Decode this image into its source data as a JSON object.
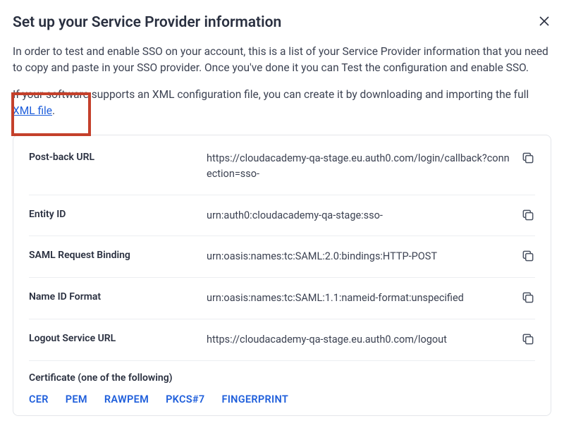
{
  "title": "Set up your Service Provider information",
  "desc1": "In order to test and enable SSO on your account, this is a list of your Service Provider information that you need to copy and paste in your SSO provider. Once you've done it you can Test the configuration and enable SSO.",
  "desc2_prefix": "If your software supports an XML configuration file, you can create it by downloading and importing the full ",
  "desc2_link": "XML file",
  "desc2_suffix": ".",
  "rows": {
    "postback": {
      "label": "Post-back URL",
      "value": "https://cloudacademy-qa-stage.eu.auth0.com/login/callback?connection=sso-"
    },
    "entity": {
      "label": "Entity ID",
      "value": "urn:auth0:cloudacademy-qa-stage:sso-"
    },
    "saml": {
      "label": "SAML Request Binding",
      "value": "urn:oasis:names:tc:SAML:2.0:bindings:HTTP-POST"
    },
    "nameid": {
      "label": "Name ID Format",
      "value": "urn:oasis:names:tc:SAML:1.1:nameid-format:unspecified"
    },
    "logout": {
      "label": "Logout Service URL",
      "value": "https://cloudacademy-qa-stage.eu.auth0.com/logout"
    }
  },
  "cert": {
    "label": "Certificate (one of the following)",
    "formats": {
      "cer": "CER",
      "pem": "PEM",
      "rawpem": "RAWPEM",
      "pkcs7": "PKCS#7",
      "fingerprint": "FINGERPRINT"
    }
  }
}
